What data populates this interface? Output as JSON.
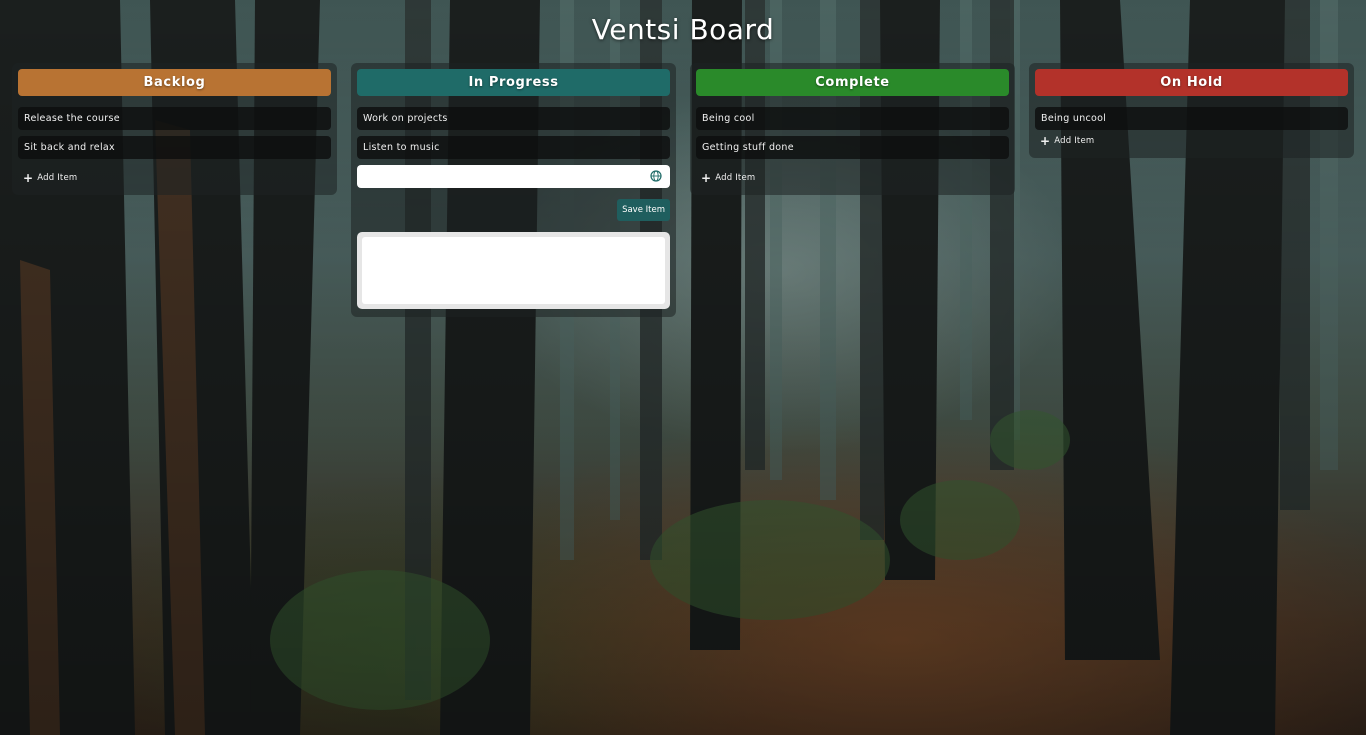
{
  "board": {
    "title": "Ventsi Board"
  },
  "columns": [
    {
      "name": "Backlog",
      "color": "#b87333",
      "items": [
        "Release the course",
        "Sit back and relax"
      ],
      "add_label": "Add Item"
    },
    {
      "name": "In Progress",
      "color": "#1f6b68",
      "items": [
        "Work on projects",
        "Listen to music"
      ],
      "input_value": "",
      "save_label": "Save Item"
    },
    {
      "name": "Complete",
      "color": "#2a8a2a",
      "items": [
        "Being cool",
        "Getting stuff done"
      ],
      "add_label": "Add Item"
    },
    {
      "name": "On Hold",
      "color": "#b3322a",
      "items": [
        "Being uncool"
      ],
      "add_label": "Add Item"
    }
  ],
  "icons": {
    "add": "plus-icon",
    "input": "globe-icon"
  }
}
